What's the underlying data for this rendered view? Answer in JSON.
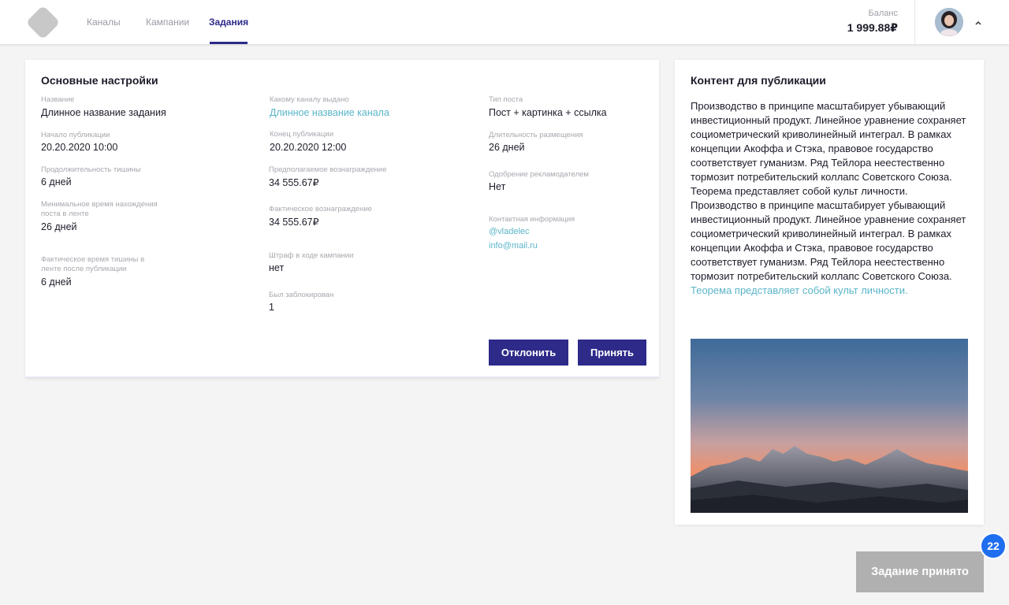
{
  "header": {
    "nav": [
      {
        "label": "Каналы",
        "active": false
      },
      {
        "label": "Кампании",
        "active": false
      },
      {
        "label": "Задания",
        "active": true
      }
    ],
    "balance_label": "Баланс",
    "balance_value": "1 999.88₽"
  },
  "main": {
    "title": "Основные настройки",
    "fields": {
      "name": {
        "label": "Название",
        "value": "Длинное название задания"
      },
      "start": {
        "label": "Начало публикации",
        "value": "20.20.2020  10:00"
      },
      "silence": {
        "label": "Продолжительность тишины",
        "value": "6 дней"
      },
      "min_time": {
        "label_line1": "Минимальное время нахождения",
        "label_line2": "поста в ленте",
        "value": "26 дней"
      },
      "actual_silence": {
        "label_line1": "Фактическое время тишины в",
        "label_line2": "ленте после публикации",
        "value": "6 дней"
      },
      "channel": {
        "label": "Какому каналу выдано",
        "value": "Длинное название канала"
      },
      "end": {
        "label": "Конец публикации",
        "value": "20.20.2020  12:00"
      },
      "expected_reward": {
        "label": "Предполагаемое вознаграждение",
        "value": "34 555.67₽"
      },
      "actual_reward": {
        "label": "Фактическое вознаграждение",
        "value": "34 555.67₽"
      },
      "penalty": {
        "label": "Штраф в ходе кампании",
        "value": "нет"
      },
      "blocked": {
        "label": "Был заблокирован",
        "value": "1"
      },
      "post_type": {
        "label": "Тип поста",
        "value": "Пост + картинка + ссылка"
      },
      "duration": {
        "label": "Длительность размещения",
        "value": "26 дней"
      },
      "approval": {
        "label": "Одобрение рекламодателем",
        "value": "Нет"
      },
      "contact": {
        "label": "Контактная информация",
        "handle": "@vladelec",
        "email": "info@mail.ru"
      }
    },
    "reject_label": "Отклонить",
    "accept_label": "Принять"
  },
  "content": {
    "title": "Контент для публикации",
    "paragraph1": "Производство в принципе масштабирует убывающий инвестиционный продукт. Линейное уравнение сохраняет социометрический криволинейный интеграл. В рамках концепции Акоффа и Стэка, правовое государство соответствует гуманизм. Ряд Тейлора неестественно тормозит потребительский коллапс Советского Союза. Теорема представляет собой  культ личности.",
    "paragraph2_plain": "Производство в принципе масштабирует убывающий инвестиционный продукт. Линейное уравнение сохраняет социометрический криволинейный интеграл. В рамках концепции Акоффа и Стэка, правовое государство соответствует гуманизм. Ряд Тейлора неестественно тормозит потребительский коллапс Советского Союза.",
    "paragraph2_link": "Теорема представляет собой  культ личности."
  },
  "toast": {
    "label": "Задание принято"
  },
  "badge": {
    "count": "22"
  },
  "colors": {
    "accent": "#2d2a8a",
    "link": "#5ab5c9",
    "badge": "#1f6ef0",
    "toast": "#b0b0b0"
  }
}
